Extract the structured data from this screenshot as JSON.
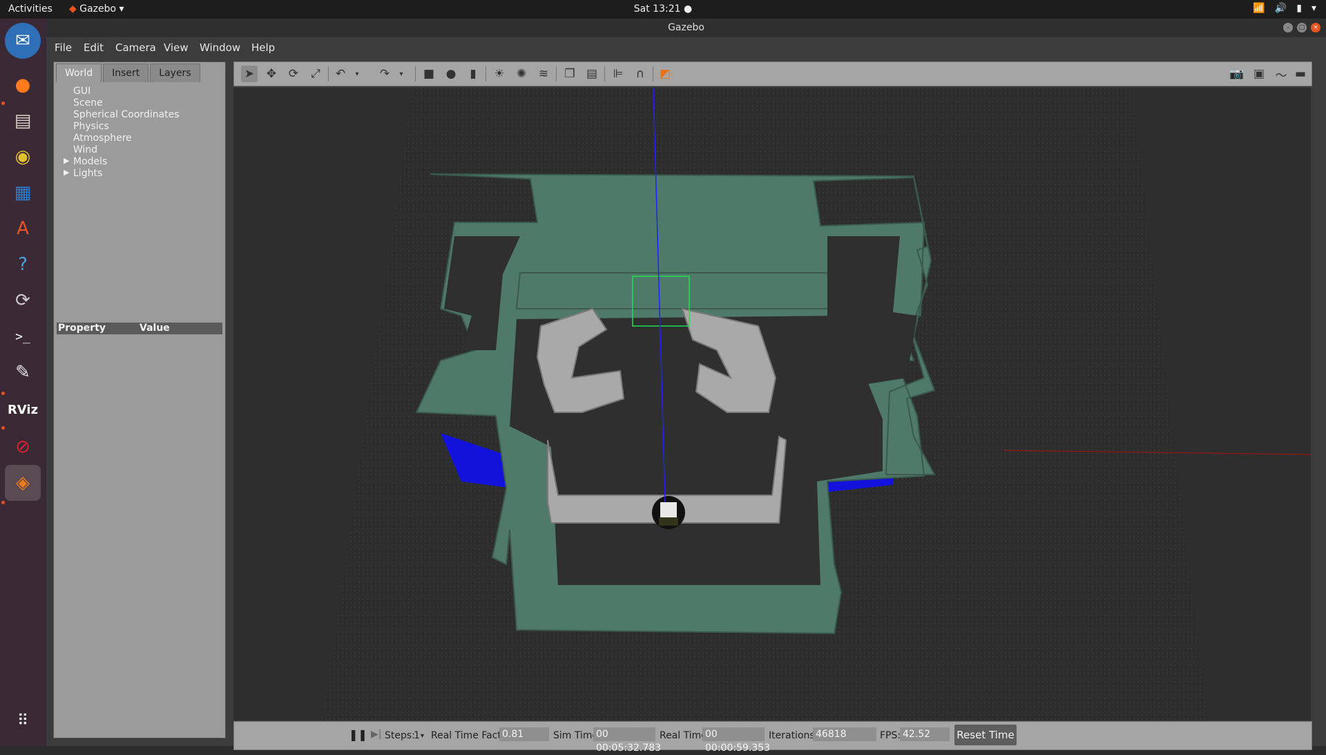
{
  "topbar": {
    "activities": "Activities",
    "app_name": "Gazebo",
    "clock": "Sat 13:21"
  },
  "window": {
    "title": "Gazebo"
  },
  "menu": {
    "file": "File",
    "edit": "Edit",
    "camera": "Camera",
    "view": "View",
    "window": "Window",
    "help": "Help"
  },
  "panel": {
    "tabs": [
      "World",
      "Insert",
      "Layers"
    ],
    "tree": [
      {
        "label": "GUI",
        "expandable": false
      },
      {
        "label": "Scene",
        "expandable": false
      },
      {
        "label": "Spherical Coordinates",
        "expandable": false
      },
      {
        "label": "Physics",
        "expandable": false
      },
      {
        "label": "Atmosphere",
        "expandable": false
      },
      {
        "label": "Wind",
        "expandable": false
      },
      {
        "label": "Models",
        "expandable": true
      },
      {
        "label": "Lights",
        "expandable": true
      }
    ],
    "property_header": "Property",
    "value_header": "Value"
  },
  "bottom": {
    "steps_label": "Steps:",
    "steps_value": "1",
    "rtf_label": "Real Time Factor:",
    "rtf_value": "0.81",
    "sim_time_label": "Sim Time:",
    "sim_time_value": "00 00:05:32.783",
    "real_time_label": "Real Time:",
    "real_time_value": "00 00:00:59.353",
    "iterations_label": "Iterations:",
    "iterations_value": "46818",
    "fps_label": "FPS:",
    "fps_value": "42.52",
    "reset_label": "Reset Time"
  },
  "colors": {
    "wall_green": "#4f7a69",
    "wall_gray": "#a9a9a9",
    "laser_blue": "#1010f0",
    "ground": "#2f2f2f",
    "accent": "#e95420"
  }
}
